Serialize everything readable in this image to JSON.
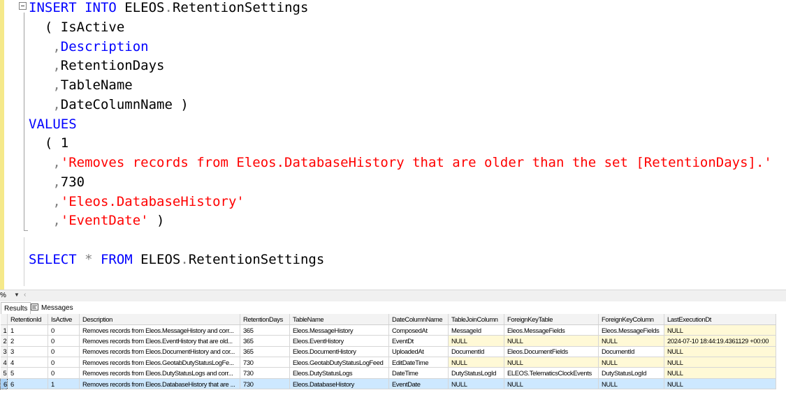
{
  "editor": {
    "lines": [
      [
        {
          "t": "INSERT INTO ",
          "c": "kw"
        },
        {
          "t": "ELEOS",
          "c": "blk"
        },
        {
          "t": ".",
          "c": "gray"
        },
        {
          "t": "RetentionSettings",
          "c": "blk"
        }
      ],
      [
        {
          "t": "  ( IsActive",
          "c": "blk"
        }
      ],
      [
        {
          "t": "   ,",
          "c": "gray"
        },
        {
          "t": "Description",
          "c": "kw"
        }
      ],
      [
        {
          "t": "   ,",
          "c": "gray"
        },
        {
          "t": "RetentionDays",
          "c": "blk"
        }
      ],
      [
        {
          "t": "   ,",
          "c": "gray"
        },
        {
          "t": "TableName",
          "c": "blk"
        }
      ],
      [
        {
          "t": "   ,",
          "c": "gray"
        },
        {
          "t": "DateColumnName )",
          "c": "blk"
        }
      ],
      [
        {
          "t": "VALUES",
          "c": "kw"
        }
      ],
      [
        {
          "t": "  ( 1",
          "c": "blk"
        }
      ],
      [
        {
          "t": "   ,",
          "c": "gray"
        },
        {
          "t": "'Removes records from Eleos.DatabaseHistory that are older than the set [RetentionDays].'",
          "c": "str"
        }
      ],
      [
        {
          "t": "   ,",
          "c": "gray"
        },
        {
          "t": "730",
          "c": "blk"
        }
      ],
      [
        {
          "t": "   ,",
          "c": "gray"
        },
        {
          "t": "'Eleos.DatabaseHistory'",
          "c": "str"
        }
      ],
      [
        {
          "t": "   ,",
          "c": "gray"
        },
        {
          "t": "'EventDate'",
          "c": "str"
        },
        {
          "t": " )",
          "c": "blk"
        }
      ],
      [],
      [
        {
          "t": "SELECT ",
          "c": "kw"
        },
        {
          "t": "* ",
          "c": "gray"
        },
        {
          "t": "FROM ",
          "c": "kw"
        },
        {
          "t": "ELEOS",
          "c": "blk"
        },
        {
          "t": ".",
          "c": "gray"
        },
        {
          "t": "RetentionSettings",
          "c": "blk"
        }
      ]
    ]
  },
  "zoombar": {
    "zoom_label": "%",
    "dropdown_icon": "chevron-down-icon",
    "scroll_left_icon": "arrow-left-icon"
  },
  "tabs": {
    "results_label": "Results",
    "messages_label": "Messages"
  },
  "grid": {
    "columns": [
      "RetentionId",
      "IsActive",
      "Description",
      "RetentionDays",
      "TableName",
      "DateColumnName",
      "TableJoinColumn",
      "ForeignKeyTable",
      "ForeignKeyColumn",
      "LastExecutionDt"
    ],
    "rows": [
      {
        "num": "1",
        "cells": [
          "1",
          "0",
          "Removes records from Eleos.MessageHistory and corr...",
          "365",
          "Eleos.MessageHistory",
          "ComposedAt",
          "MessageId",
          "Eleos.MessageFields",
          "Eleos.MessageFields",
          "NULL"
        ]
      },
      {
        "num": "2",
        "cells": [
          "2",
          "0",
          "Removes records from Eleos.EventHistory that are old...",
          "365",
          "Eleos.EventHistory",
          "EventDt",
          "NULL",
          "NULL",
          "NULL",
          "2024-07-10 18:44:19.4361129 +00:00"
        ]
      },
      {
        "num": "3",
        "cells": [
          "3",
          "0",
          "Removes records from Eleos.DocumentHistory and cor...",
          "365",
          "Eleos.DocumentHistory",
          "UploadedAt",
          "DocumentId",
          "Eleos.DocumentFields",
          "DocumentId",
          "NULL"
        ]
      },
      {
        "num": "4",
        "cells": [
          "4",
          "0",
          "Removes records from Eleos.GeotabDutyStatusLogFe...",
          "730",
          "Eleos.GeotabDutyStatusLogFeed",
          "EditDateTime",
          "NULL",
          "NULL",
          "NULL",
          "NULL"
        ]
      },
      {
        "num": "5",
        "cells": [
          "5",
          "0",
          "Removes records from Eleos.DutyStatusLogs and corr...",
          "730",
          "Eleos.DutyStatusLogs",
          "DateTime",
          "DutyStatusLogId",
          "ELEOS.TelematicsClockEvents",
          "DutyStatusLogId",
          "NULL"
        ]
      },
      {
        "num": "6",
        "cells": [
          "6",
          "1",
          "Removes records from Eleos.DatabaseHistory that are ...",
          "730",
          "Eleos.DatabaseHistory",
          "EventDate",
          "NULL",
          "NULL",
          "NULL",
          "NULL"
        ],
        "selected": true
      }
    ]
  },
  "colors": {
    "keyword": "#0000ff",
    "string": "#ff0000",
    "operator": "#808080",
    "selection": "#cde8ff",
    "null_cell": "#fff9d6"
  }
}
